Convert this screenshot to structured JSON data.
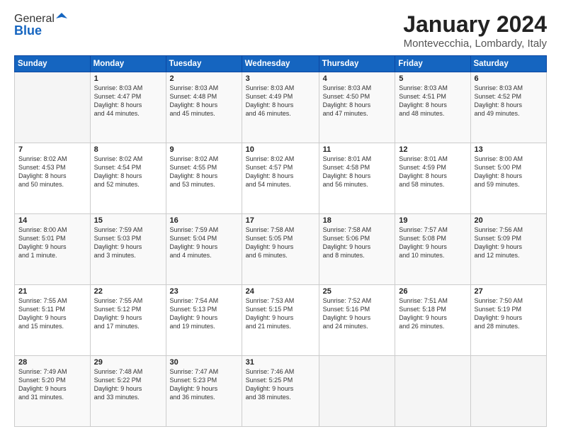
{
  "header": {
    "logo_general": "General",
    "logo_blue": "Blue",
    "month_title": "January 2024",
    "location": "Montevecchia, Lombardy, Italy"
  },
  "days_of_week": [
    "Sunday",
    "Monday",
    "Tuesday",
    "Wednesday",
    "Thursday",
    "Friday",
    "Saturday"
  ],
  "weeks": [
    [
      {
        "day": "",
        "info": ""
      },
      {
        "day": "1",
        "info": "Sunrise: 8:03 AM\nSunset: 4:47 PM\nDaylight: 8 hours\nand 44 minutes."
      },
      {
        "day": "2",
        "info": "Sunrise: 8:03 AM\nSunset: 4:48 PM\nDaylight: 8 hours\nand 45 minutes."
      },
      {
        "day": "3",
        "info": "Sunrise: 8:03 AM\nSunset: 4:49 PM\nDaylight: 8 hours\nand 46 minutes."
      },
      {
        "day": "4",
        "info": "Sunrise: 8:03 AM\nSunset: 4:50 PM\nDaylight: 8 hours\nand 47 minutes."
      },
      {
        "day": "5",
        "info": "Sunrise: 8:03 AM\nSunset: 4:51 PM\nDaylight: 8 hours\nand 48 minutes."
      },
      {
        "day": "6",
        "info": "Sunrise: 8:03 AM\nSunset: 4:52 PM\nDaylight: 8 hours\nand 49 minutes."
      }
    ],
    [
      {
        "day": "7",
        "info": "Sunrise: 8:02 AM\nSunset: 4:53 PM\nDaylight: 8 hours\nand 50 minutes."
      },
      {
        "day": "8",
        "info": "Sunrise: 8:02 AM\nSunset: 4:54 PM\nDaylight: 8 hours\nand 52 minutes."
      },
      {
        "day": "9",
        "info": "Sunrise: 8:02 AM\nSunset: 4:55 PM\nDaylight: 8 hours\nand 53 minutes."
      },
      {
        "day": "10",
        "info": "Sunrise: 8:02 AM\nSunset: 4:57 PM\nDaylight: 8 hours\nand 54 minutes."
      },
      {
        "day": "11",
        "info": "Sunrise: 8:01 AM\nSunset: 4:58 PM\nDaylight: 8 hours\nand 56 minutes."
      },
      {
        "day": "12",
        "info": "Sunrise: 8:01 AM\nSunset: 4:59 PM\nDaylight: 8 hours\nand 58 minutes."
      },
      {
        "day": "13",
        "info": "Sunrise: 8:00 AM\nSunset: 5:00 PM\nDaylight: 8 hours\nand 59 minutes."
      }
    ],
    [
      {
        "day": "14",
        "info": "Sunrise: 8:00 AM\nSunset: 5:01 PM\nDaylight: 9 hours\nand 1 minute."
      },
      {
        "day": "15",
        "info": "Sunrise: 7:59 AM\nSunset: 5:03 PM\nDaylight: 9 hours\nand 3 minutes."
      },
      {
        "day": "16",
        "info": "Sunrise: 7:59 AM\nSunset: 5:04 PM\nDaylight: 9 hours\nand 4 minutes."
      },
      {
        "day": "17",
        "info": "Sunrise: 7:58 AM\nSunset: 5:05 PM\nDaylight: 9 hours\nand 6 minutes."
      },
      {
        "day": "18",
        "info": "Sunrise: 7:58 AM\nSunset: 5:06 PM\nDaylight: 9 hours\nand 8 minutes."
      },
      {
        "day": "19",
        "info": "Sunrise: 7:57 AM\nSunset: 5:08 PM\nDaylight: 9 hours\nand 10 minutes."
      },
      {
        "day": "20",
        "info": "Sunrise: 7:56 AM\nSunset: 5:09 PM\nDaylight: 9 hours\nand 12 minutes."
      }
    ],
    [
      {
        "day": "21",
        "info": "Sunrise: 7:55 AM\nSunset: 5:11 PM\nDaylight: 9 hours\nand 15 minutes."
      },
      {
        "day": "22",
        "info": "Sunrise: 7:55 AM\nSunset: 5:12 PM\nDaylight: 9 hours\nand 17 minutes."
      },
      {
        "day": "23",
        "info": "Sunrise: 7:54 AM\nSunset: 5:13 PM\nDaylight: 9 hours\nand 19 minutes."
      },
      {
        "day": "24",
        "info": "Sunrise: 7:53 AM\nSunset: 5:15 PM\nDaylight: 9 hours\nand 21 minutes."
      },
      {
        "day": "25",
        "info": "Sunrise: 7:52 AM\nSunset: 5:16 PM\nDaylight: 9 hours\nand 24 minutes."
      },
      {
        "day": "26",
        "info": "Sunrise: 7:51 AM\nSunset: 5:18 PM\nDaylight: 9 hours\nand 26 minutes."
      },
      {
        "day": "27",
        "info": "Sunrise: 7:50 AM\nSunset: 5:19 PM\nDaylight: 9 hours\nand 28 minutes."
      }
    ],
    [
      {
        "day": "28",
        "info": "Sunrise: 7:49 AM\nSunset: 5:20 PM\nDaylight: 9 hours\nand 31 minutes."
      },
      {
        "day": "29",
        "info": "Sunrise: 7:48 AM\nSunset: 5:22 PM\nDaylight: 9 hours\nand 33 minutes."
      },
      {
        "day": "30",
        "info": "Sunrise: 7:47 AM\nSunset: 5:23 PM\nDaylight: 9 hours\nand 36 minutes."
      },
      {
        "day": "31",
        "info": "Sunrise: 7:46 AM\nSunset: 5:25 PM\nDaylight: 9 hours\nand 38 minutes."
      },
      {
        "day": "",
        "info": ""
      },
      {
        "day": "",
        "info": ""
      },
      {
        "day": "",
        "info": ""
      }
    ]
  ]
}
